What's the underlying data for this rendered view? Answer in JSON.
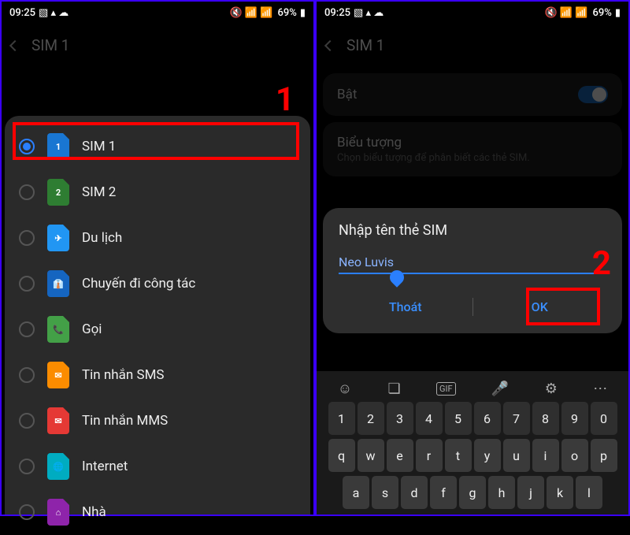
{
  "status": {
    "time": "09:25",
    "battery_pct": "69%"
  },
  "header": {
    "title": "SIM 1"
  },
  "step_labels": {
    "one": "1",
    "two": "2"
  },
  "sim_options": [
    {
      "label": "SIM 1",
      "selected": true,
      "color": "#1976d2",
      "glyph": "1"
    },
    {
      "label": "SIM 2",
      "selected": false,
      "color": "#2e7d32",
      "glyph": "2"
    },
    {
      "label": "Du lịch",
      "selected": false,
      "color": "#2196f3",
      "glyph": "✈"
    },
    {
      "label": "Chuyến đi công tác",
      "selected": false,
      "color": "#1565c0",
      "glyph": "👔"
    },
    {
      "label": "Gọi",
      "selected": false,
      "color": "#43a047",
      "glyph": "📞"
    },
    {
      "label": "Tin nhắn SMS",
      "selected": false,
      "color": "#fb8c00",
      "glyph": "✉"
    },
    {
      "label": "Tin nhắn MMS",
      "selected": false,
      "color": "#e53935",
      "glyph": "✉"
    },
    {
      "label": "Internet",
      "selected": false,
      "color": "#00acc1",
      "glyph": "🌐"
    },
    {
      "label": "Nhà",
      "selected": false,
      "color": "#8e24aa",
      "glyph": "⌂"
    }
  ],
  "screen2": {
    "enable_label": "Bật",
    "icon_row_title": "Biểu tượng",
    "icon_row_sub": "Chọn biểu tượng để phân biết các thẻ SIM.",
    "dialog_title": "Nhập tên thẻ SIM",
    "input_value": "Neo Luvis",
    "cancel_label": "Thoát",
    "ok_label": "OK"
  },
  "keyboard": {
    "numbers": [
      "1",
      "2",
      "3",
      "4",
      "5",
      "6",
      "7",
      "8",
      "9",
      "0"
    ],
    "row1": [
      "q",
      "w",
      "e",
      "r",
      "t",
      "y",
      "u",
      "i",
      "o",
      "p"
    ],
    "row2": [
      "a",
      "s",
      "d",
      "f",
      "g",
      "h",
      "j",
      "k",
      "l"
    ]
  }
}
